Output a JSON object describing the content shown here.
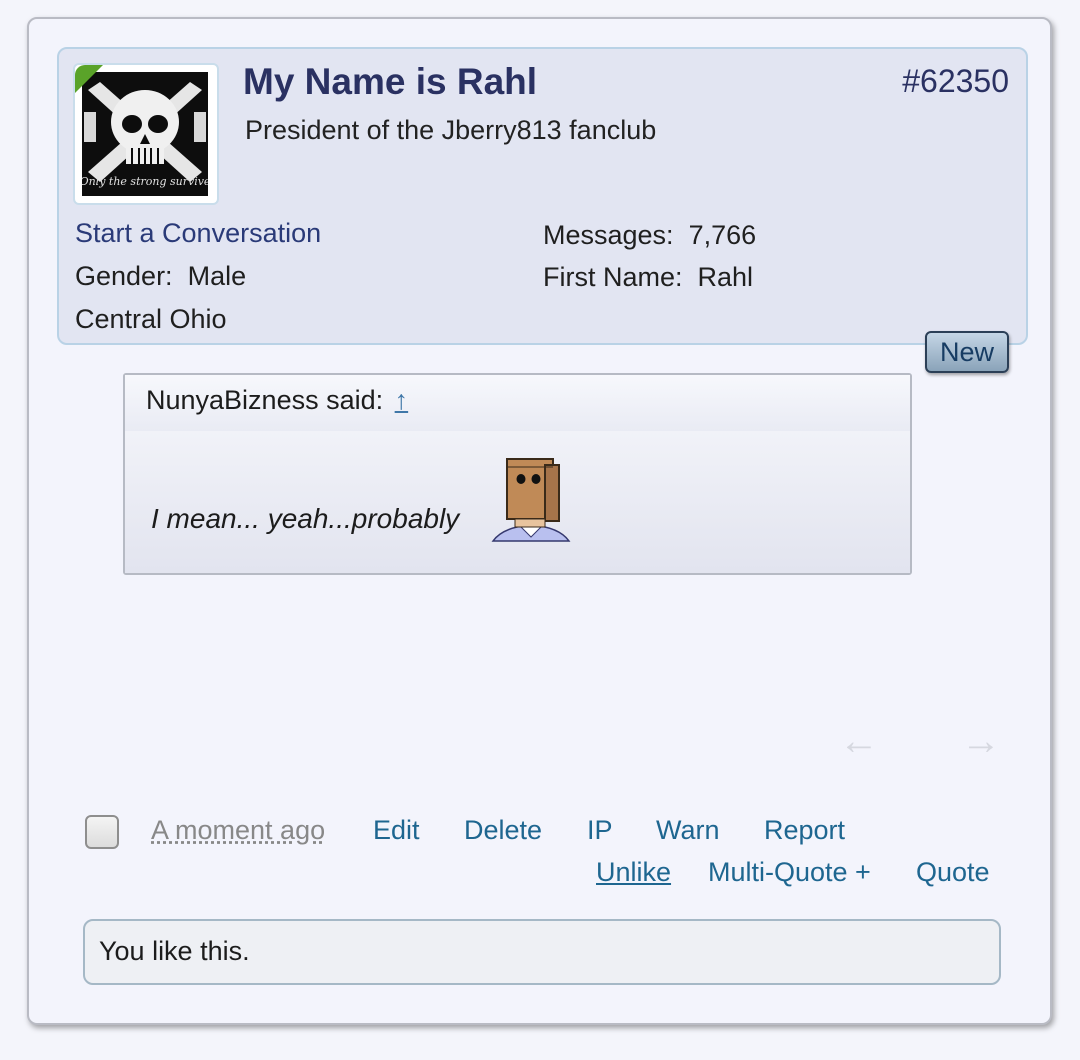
{
  "post": {
    "number": "#62350",
    "user": {
      "name": "My Name is Rahl",
      "title": "President of the Jberry813 fanclub",
      "avatar_caption": "Only the strong survive",
      "start_conversation": "Start a Conversation",
      "gender_label": "Gender:",
      "gender": "Male",
      "location": "Central Ohio",
      "messages_label": "Messages:",
      "messages": "7,766",
      "first_name_label": "First Name:",
      "first_name": "Rahl"
    },
    "new_badge": "New",
    "quote": {
      "author_line": "NunyaBizness said:",
      "jump_link": "↑",
      "text": "I mean... yeah...probably",
      "smiley_icon": "paper-bag-head-smiley-icon"
    },
    "nav": {
      "prev_icon": "←",
      "next_icon": "→"
    },
    "footer": {
      "timestamp": "A moment ago",
      "edit": "Edit",
      "delete": "Delete",
      "ip": "IP",
      "warn": "Warn",
      "report": "Report",
      "unlike": "Unlike",
      "multi_quote": "Multi-Quote +",
      "quote": "Quote"
    },
    "likes_summary": "You like this."
  },
  "colors": {
    "username": "#2a3162",
    "link": "#1e6690",
    "online_indicator": "#5aa329"
  }
}
